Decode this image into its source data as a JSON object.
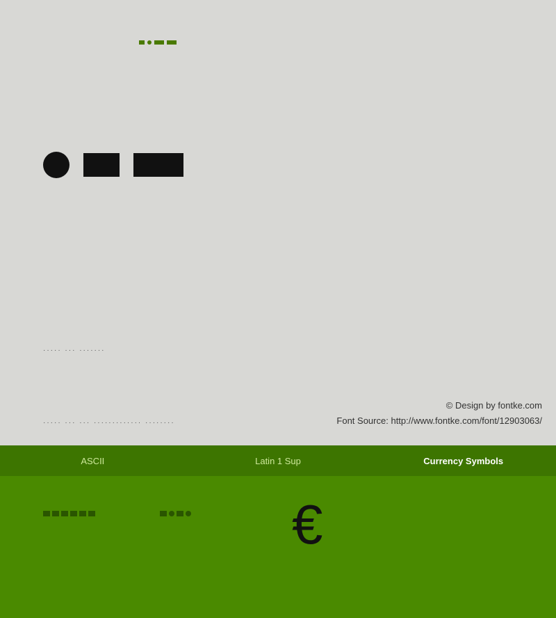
{
  "top": {
    "design_credit": "© Design by fontke.com",
    "font_source_label": "Font Source:",
    "font_source_url": "http://www.fontke.com/font/12903063/"
  },
  "bottom": {
    "tabs": [
      {
        "id": "ascii",
        "label": "ASCII"
      },
      {
        "id": "latin1sup",
        "label": "Latin 1 Sup"
      },
      {
        "id": "currency",
        "label": "Currency Symbols"
      }
    ],
    "euro_symbol": "€"
  },
  "patterns": {
    "dots_top": "■·■■",
    "small_text_1": "·····  ···  ·······",
    "small_text_2": "·····  ···  ···  ·············  ········"
  }
}
